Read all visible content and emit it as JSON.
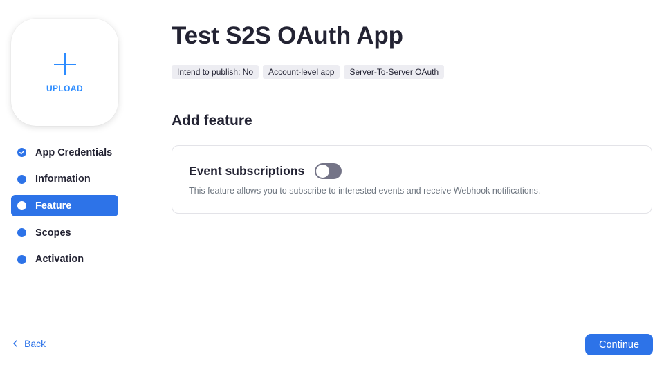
{
  "sidebar": {
    "upload_label": "UPLOAD",
    "steps": [
      {
        "label": "App Credentials",
        "state": "completed"
      },
      {
        "label": "Information",
        "state": "default"
      },
      {
        "label": "Feature",
        "state": "active"
      },
      {
        "label": "Scopes",
        "state": "default"
      },
      {
        "label": "Activation",
        "state": "default"
      }
    ]
  },
  "header": {
    "title": "Test S2S OAuth App",
    "tags": [
      "Intend to publish: No",
      "Account-level app",
      "Server-To-Server OAuth"
    ]
  },
  "main": {
    "section_title": "Add feature",
    "feature": {
      "name": "Event subscriptions",
      "toggle_on": false,
      "description": "This feature allows you to subscribe to interested events and receive Webhook notifications."
    }
  },
  "footer": {
    "back_label": "Back",
    "continue_label": "Continue"
  },
  "colors": {
    "accent": "#2d73e8",
    "upload_accent": "#2d8cff",
    "toggle_off": "#747487",
    "text": "#232333"
  },
  "icons": {
    "upload": "plus-icon",
    "completed_step": "check-icon",
    "back": "chevron-left-icon"
  }
}
